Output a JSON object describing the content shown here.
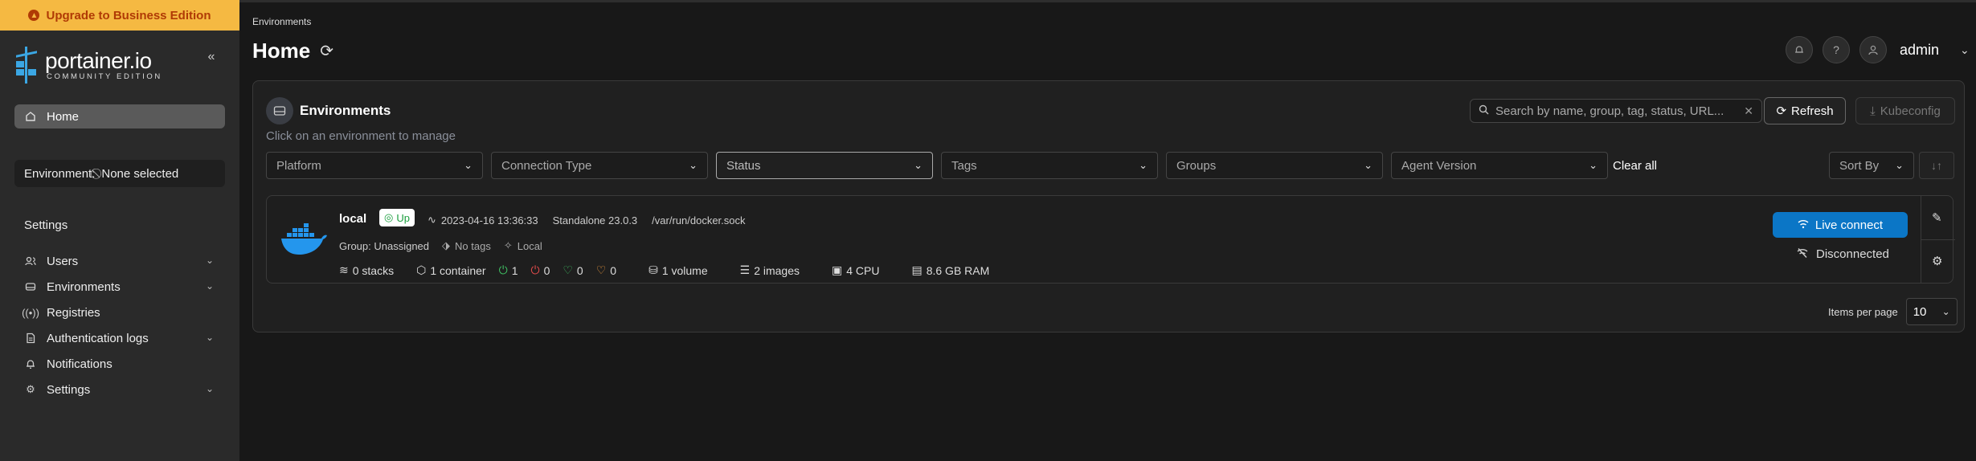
{
  "sidebar": {
    "upgrade_label": "Upgrade to Business Edition",
    "brand": "portainer.io",
    "edition": "COMMUNITY EDITION",
    "home_label": "Home",
    "environment_label": "Environment:",
    "environment_value": "None selected",
    "settings_heading": "Settings",
    "menu": [
      {
        "label": "Users",
        "icon": "users-icon",
        "expandable": true
      },
      {
        "label": "Environments",
        "icon": "environments-icon",
        "expandable": true
      },
      {
        "label": "Registries",
        "icon": "registries-icon",
        "expandable": false
      },
      {
        "label": "Authentication logs",
        "icon": "document-icon",
        "expandable": true
      },
      {
        "label": "Notifications",
        "icon": "bell-icon",
        "expandable": false
      },
      {
        "label": "Settings",
        "icon": "gear-icon",
        "expandable": true
      }
    ]
  },
  "header": {
    "breadcrumb": "Environments",
    "title": "Home",
    "user": "admin"
  },
  "panel": {
    "title": "Environments",
    "subtitle": "Click on an environment to manage",
    "search_placeholder": "Search by name, group, tag, status, URL...",
    "refresh_label": "Refresh",
    "kubeconfig_label": "Kubeconfig",
    "filters": [
      "Platform",
      "Connection Type",
      "Status",
      "Tags",
      "Groups",
      "Agent Version"
    ],
    "clear_all": "Clear all",
    "sort_by": "Sort By",
    "items_per_page_label": "Items per page",
    "items_per_page_value": "10"
  },
  "environment": {
    "name": "local",
    "status": "Up",
    "timestamp": "2023-04-16 13:36:33",
    "type": "Standalone 23.0.3",
    "socket": "/var/run/docker.sock",
    "group": "Group: Unassigned",
    "tags": "No tags",
    "location": "Local",
    "stacks": "0 stacks",
    "containers": "1 container",
    "running": "1",
    "stopped": "0",
    "healthy": "0",
    "unhealthy": "0",
    "volumes": "1 volume",
    "images": "2 images",
    "cpu": "4 CPU",
    "ram": "8.6 GB RAM",
    "live_connect": "Live connect",
    "connection_state": "Disconnected"
  },
  "colors": {
    "upgrade_bg": "#f5b942",
    "accent_blue": "#0b76c6",
    "status_green": "#3fbf62",
    "status_red": "#e24b4b",
    "status_orange": "#f09a3e"
  }
}
